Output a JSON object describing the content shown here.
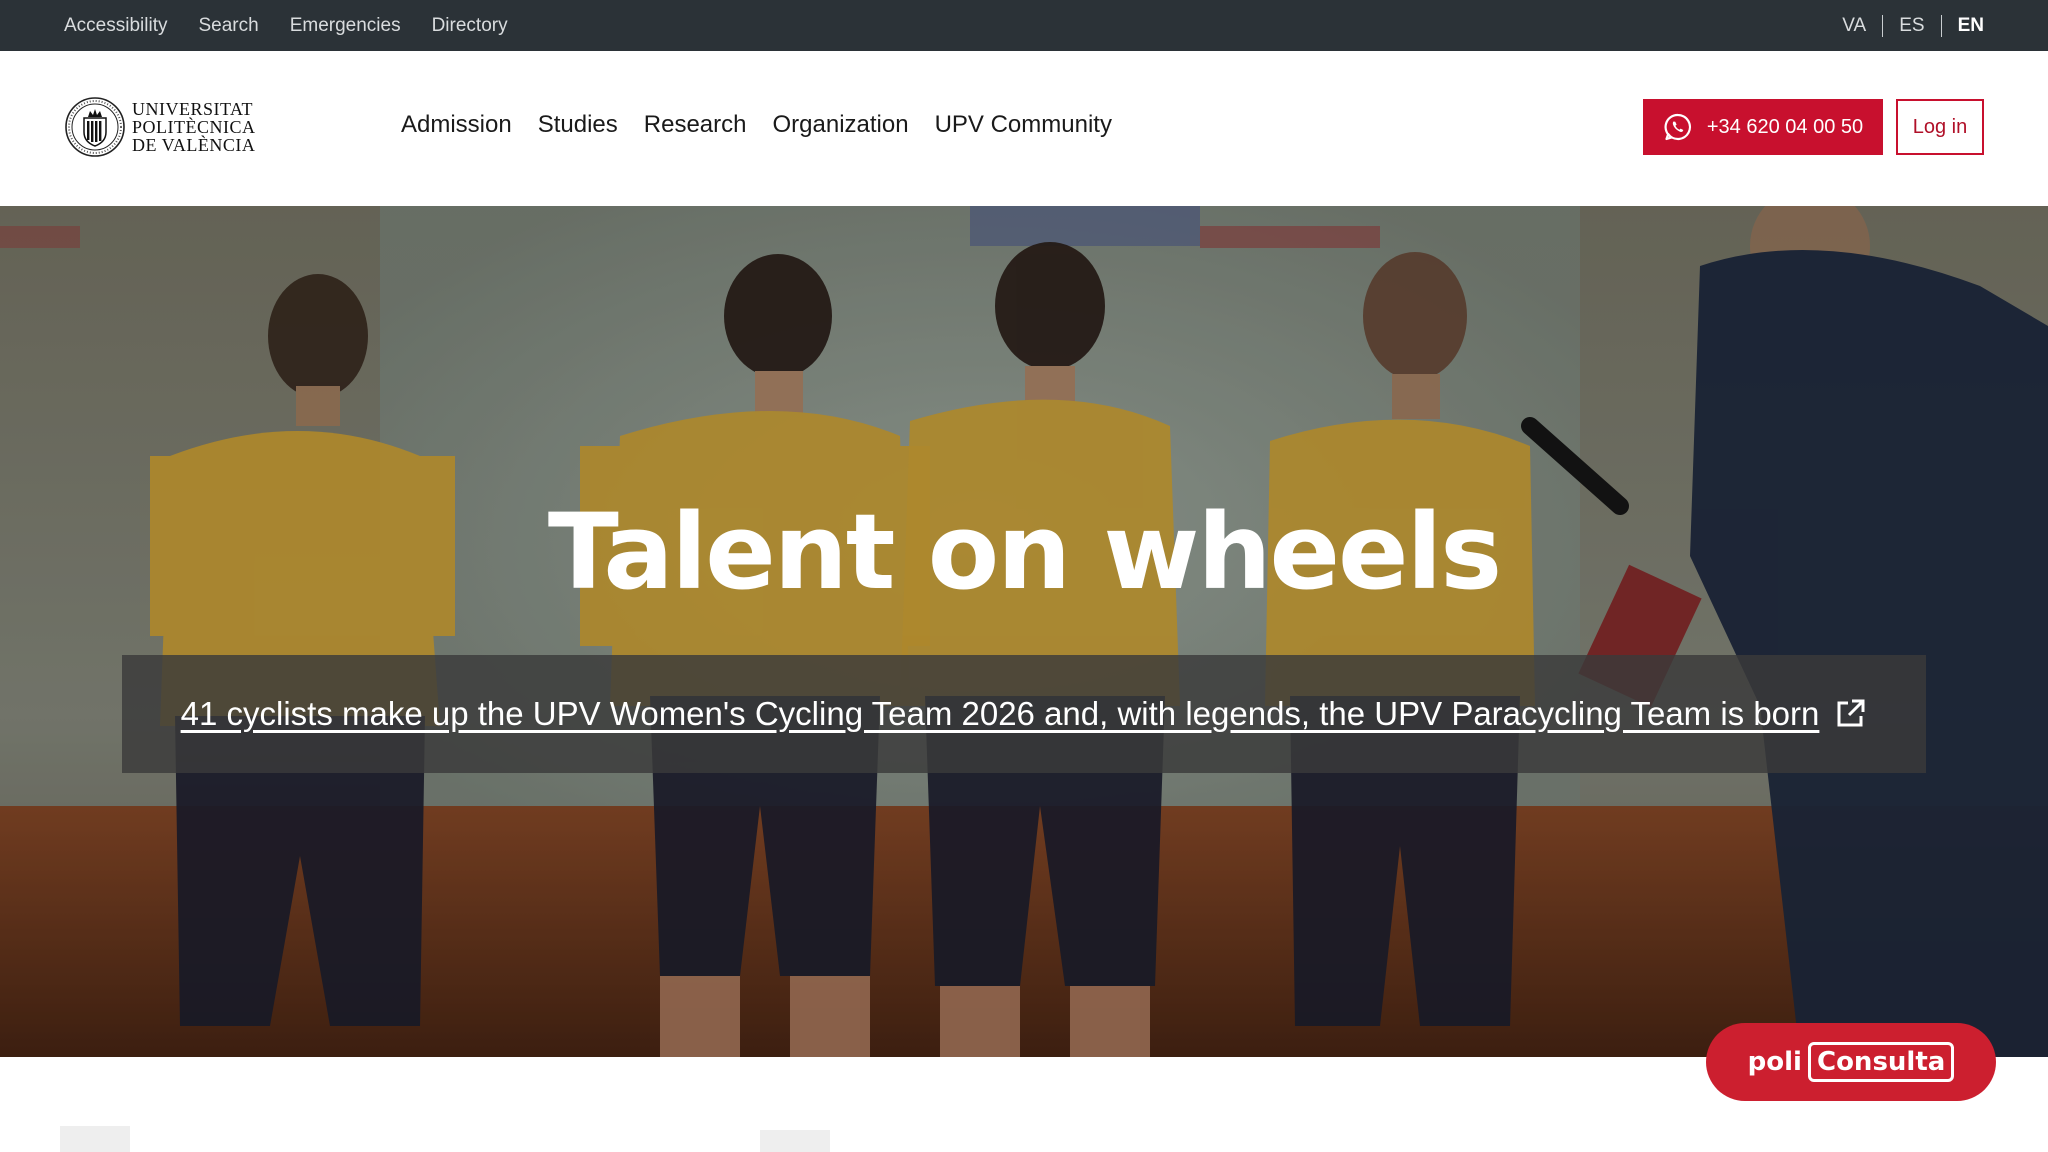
{
  "topbar": {
    "links": [
      "Accessibility",
      "Search",
      "Emergencies",
      "Directory"
    ],
    "languages": [
      "VA",
      "ES",
      "EN"
    ],
    "active_language": "EN"
  },
  "header": {
    "logo": {
      "line1": "UNIVERSITAT",
      "line2": "POLITÈCNICA",
      "line3": "DE VALÈNCIA"
    },
    "nav": [
      "Admission",
      "Studies",
      "Research",
      "Organization",
      "UPV Community"
    ],
    "phone_label": "+34 620 04 00 50",
    "login_label": "Log in"
  },
  "hero": {
    "title": "Talent on wheels",
    "caption": "41 cyclists make up the UPV Women's Cycling Team 2026 and, with legends, the UPV Paracycling Team is born"
  },
  "floating": {
    "label_prefix": "poli",
    "label_bracket": "Consulta"
  },
  "colors": {
    "topbar_bg": "#2b3237",
    "brand_red": "#c8102e",
    "jersey_yellow": "#e9b43a"
  },
  "icons": {
    "phone": "whatsapp-icon",
    "external": "external-link-icon",
    "seal": "university-seal-icon"
  }
}
